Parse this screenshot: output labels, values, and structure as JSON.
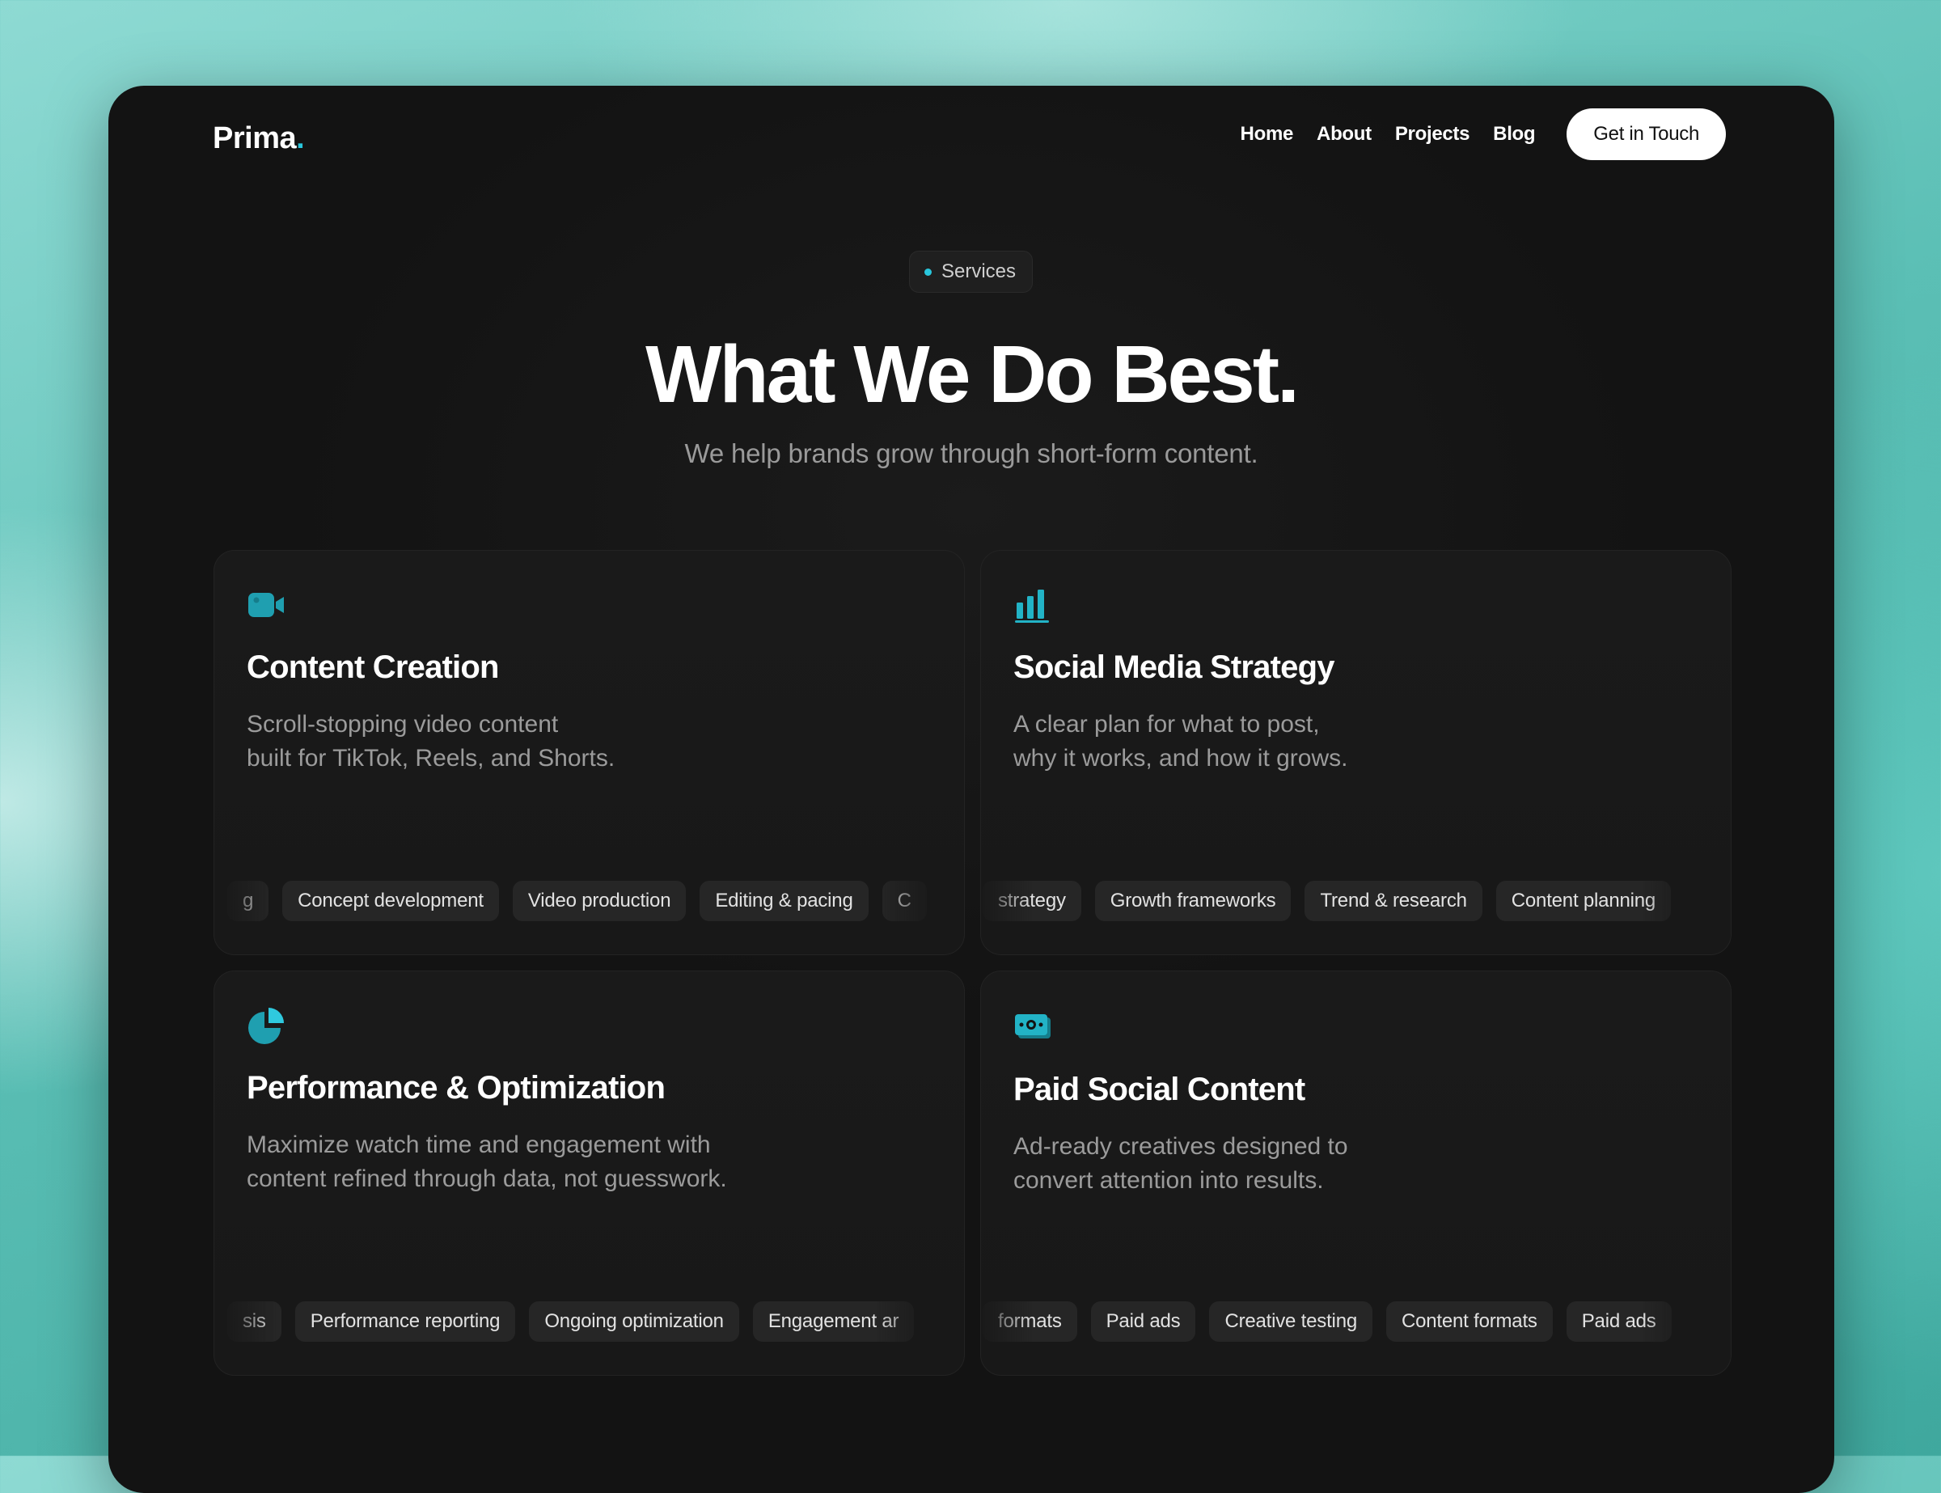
{
  "header": {
    "logo_text": "Prima",
    "logo_dot": ".",
    "nav": [
      "Home",
      "About",
      "Projects",
      "Blog"
    ],
    "cta_label": "Get in Touch"
  },
  "hero": {
    "eyebrow": "Services",
    "title": "What We Do Best.",
    "subtitle": "We help brands grow through short-form content."
  },
  "colors": {
    "accent": "#29c6dc",
    "background": "#131313",
    "card": "#1a1a1a",
    "tag": "#262626"
  },
  "services": [
    {
      "icon": "video-camera-icon",
      "title": "Content Creation",
      "desc_line1": "Scroll-stopping video content",
      "desc_line2": "built for TikTok, Reels, and Shorts.",
      "tags": [
        "g",
        "Concept development",
        "Video production",
        "Editing & pacing",
        "C"
      ]
    },
    {
      "icon": "bar-chart-icon",
      "title": "Social Media Strategy",
      "desc_line1": "A clear plan for what to post,",
      "desc_line2": "why it works, and how it grows.",
      "tags": [
        "strategy",
        "Growth frameworks",
        "Trend & research",
        "Content planning"
      ]
    },
    {
      "icon": "pie-chart-icon",
      "title": "Performance & Optimization",
      "desc_line1": "Maximize watch time and engagement with",
      "desc_line2": "content refined through data, not guesswork.",
      "tags": [
        "sis",
        "Performance reporting",
        "Ongoing optimization",
        "Engagement ar"
      ]
    },
    {
      "icon": "money-icon",
      "title": "Paid Social Content",
      "desc_line1": "Ad-ready creatives designed to",
      "desc_line2": "convert attention into results.",
      "tags": [
        "formats",
        "Paid ads",
        "Creative testing",
        "Content formats",
        "Paid ads"
      ]
    }
  ]
}
